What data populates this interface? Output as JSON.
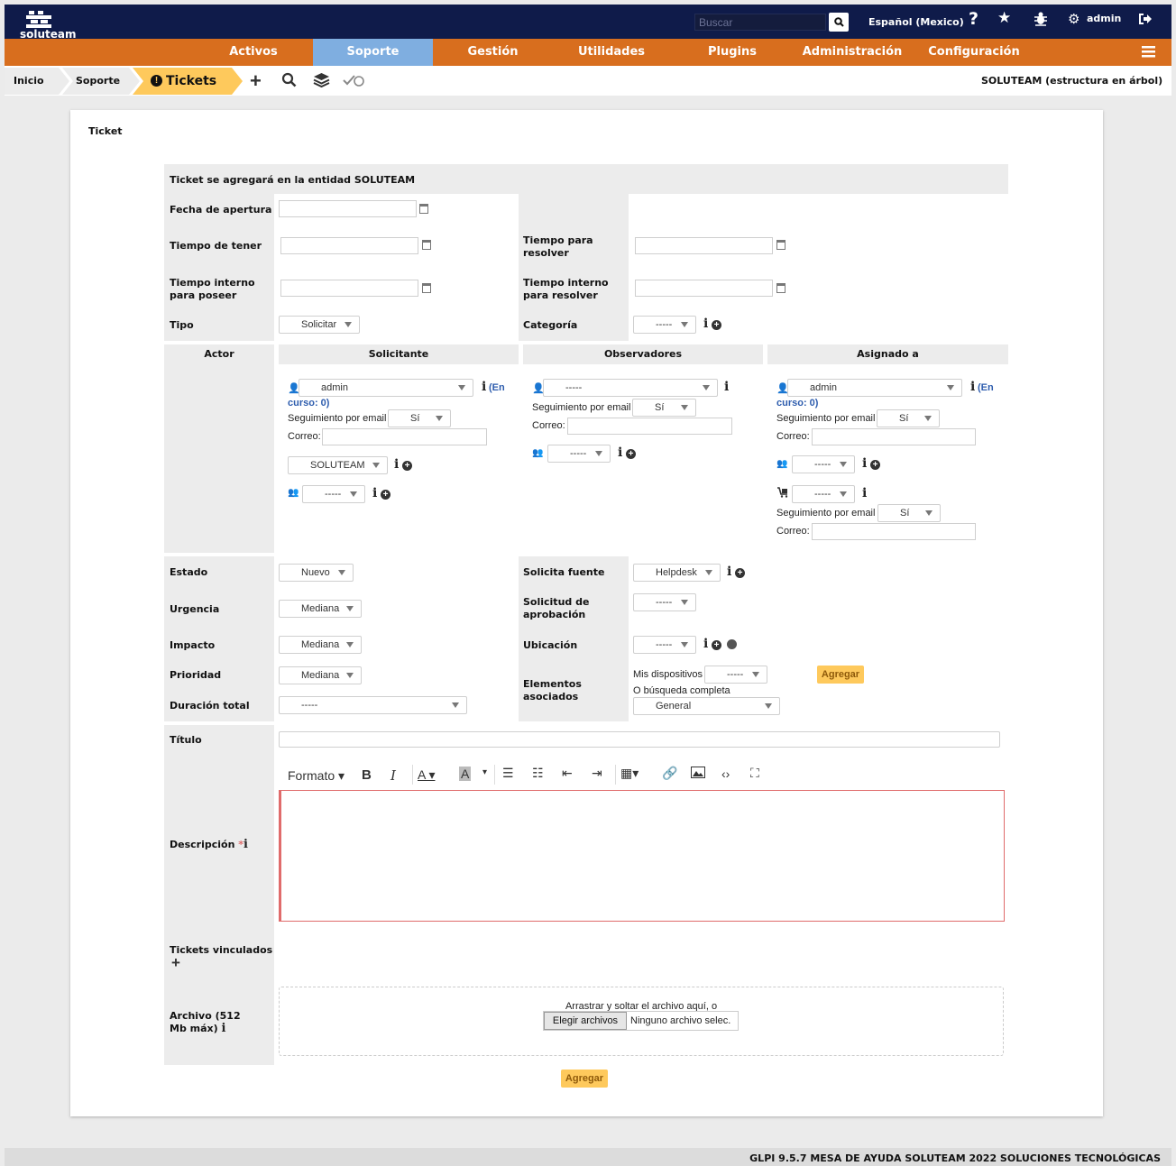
{
  "header": {
    "logo_text": "soluteam",
    "search_placeholder": "Buscar",
    "language": "Español (Mexico)",
    "user": "admin"
  },
  "nav": {
    "items": [
      "Activos",
      "Soporte",
      "Gestión",
      "Utilidades",
      "Plugins",
      "Administración",
      "Configuración"
    ],
    "active": "Soporte"
  },
  "breadcrumb": {
    "home": "Inicio",
    "section": "Soporte",
    "current": "Tickets",
    "entity": "SOLUTEAM (estructura en árbol)"
  },
  "form": {
    "title": "Ticket",
    "entity_notice": "Ticket se agregará en la entidad SOLUTEAM",
    "fecha_apertura": "Fecha de apertura",
    "tiempo_tener": "Tiempo de tener",
    "tiempo_resolver": "Tiempo para resolver",
    "tiempo_interno_poseer": "Tiempo interno para poseer",
    "tiempo_interno_resolver": "Tiempo interno para resolver",
    "tipo_label": "Tipo",
    "tipo_value": "Solicitar",
    "categoria_label": "Categoría",
    "dash": "-----",
    "actor": "Actor",
    "solicitante": "Solicitante",
    "observadores": "Observadores",
    "asignado": "Asignado a",
    "admin": "admin",
    "en_curso_1": "(En",
    "en_curso_2": "curso: 0)",
    "seguimiento": "Seguimiento por email",
    "si": "Sí",
    "correo": "Correo:",
    "entidad": "SOLUTEAM",
    "estado_label": "Estado",
    "estado_value": "Nuevo",
    "urgencia_label": "Urgencia",
    "urgencia_value": "Mediana",
    "impacto_label": "Impacto",
    "impacto_value": "Mediana",
    "prioridad_label": "Prioridad",
    "prioridad_value": "Mediana",
    "duracion_label": "Duración total",
    "fuente_label": "Solicita fuente",
    "fuente_value": "Helpdesk",
    "aprobacion_label": "Solicitud de aprobación",
    "ubicacion_label": "Ubicación",
    "elementos_label": "Elementos asociados",
    "mis_dispositivos": "Mis dispositivos",
    "busqueda_completa": "O búsqueda completa",
    "general": "General",
    "agregar": "Agregar",
    "titulo_label": "Título",
    "formato": "Formato",
    "descripcion_label": "Descripción",
    "vinculados_label": "Tickets vinculados",
    "archivo_label": "Archivo (512 Mb máx)",
    "drop_text": "Arrastrar y soltar el archivo aquí, o",
    "choose_files": "Elegir archivos",
    "no_file": "Ninguno archivo selec."
  },
  "footer": {
    "text": "GLPI 9.5.7 MESA DE AYUDA SOLUTEAM 2022 SOLUCIONES TECNOLÓGICAS"
  },
  "colors": {
    "topbar": "#0f1b4a",
    "navbar": "#d86e1e",
    "active_tab": "#7faee0",
    "button": "#fec95c"
  }
}
